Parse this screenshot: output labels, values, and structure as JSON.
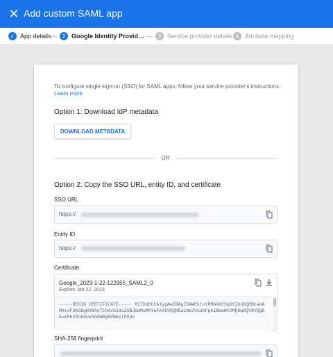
{
  "header": {
    "title": "Add custom SAML app",
    "close_icon": "close-icon"
  },
  "stepper": {
    "steps": [
      {
        "num": "✓",
        "label": "App details",
        "state": "done"
      },
      {
        "num": "2",
        "label": "Google Identity Provider details",
        "state": "active"
      },
      {
        "num": "3",
        "label": "Service provider details",
        "state": "inactive"
      },
      {
        "num": "4",
        "label": "Attribute mapping",
        "state": "inactive"
      }
    ]
  },
  "card": {
    "intro": "To configure single sign-on (SSO) for SAML apps, follow your service provider's instructions.",
    "learn_more": "Learn more",
    "option1_title": "Option 1: Download IdP metadata",
    "download_button": "DOWNLOAD METADATA",
    "or_text": "OR",
    "option2_title": "Option 2: Copy the SSO URL, entity ID, and certificate",
    "sso_url": {
      "label": "SSO URL",
      "value": "https://"
    },
    "entity_id": {
      "label": "Entity ID",
      "value": "https://"
    },
    "certificate": {
      "label": "Certificate",
      "name": "Google_2023-1-22-122955_SAML2_0",
      "expires": "Expires Jan 22, 2023",
      "text": "-----BEGIN CERTIFICATE----- MIIDdDCCAlygAwIBAgIGAWEktotPMA0GCSqGSIb3DQEBCwUAMHsxFDASBgNVBAoTC0dvb2dsZSBJbmMuMRYwFAYDVQQHEw1Nb3VudGFpbiBWaWV3MQ8wDQYDVQQDEwZHb29nbGUxGDAWBgNVBAsTD0dv"
    },
    "sha256": {
      "label": "SHA-256 fingerprint"
    }
  },
  "colors": {
    "accent": "#1a73e8",
    "background": "#e9e9e9"
  }
}
